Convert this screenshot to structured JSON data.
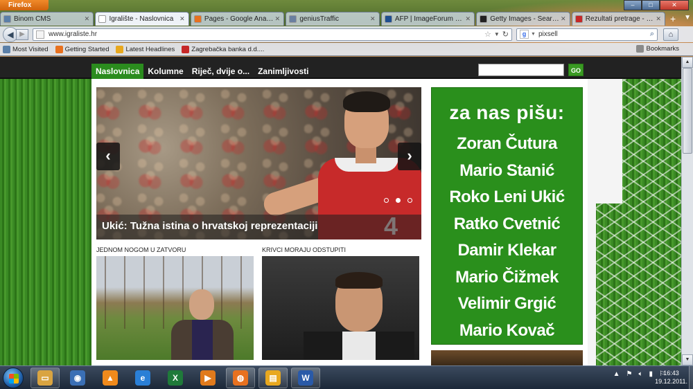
{
  "browser": {
    "app_button": "Firefox",
    "tabs": [
      {
        "label": "Binom CMS",
        "active": false,
        "favicon_color": "#5b7fa8"
      },
      {
        "label": "Igralište - Naslovnica",
        "active": true,
        "favicon_color": "#ffffff"
      },
      {
        "label": "Pages - Google Analytics",
        "active": false,
        "favicon_color": "#e8711f"
      },
      {
        "label": "geniusTraffic",
        "active": false,
        "favicon_color": "#6a7fa0"
      },
      {
        "label": "AFP | ImageForum Down...",
        "active": false,
        "favicon_color": "#1f4f8f"
      },
      {
        "label": "Getty Images - Search: cr...",
        "active": false,
        "favicon_color": "#222222"
      },
      {
        "label": "Rezultati pretrage - Pixsel...",
        "active": false,
        "favicon_color": "#c62828"
      }
    ],
    "url": "www.igraliste.hr",
    "search_value": "pixsell",
    "bookmarks": [
      {
        "label": "Most Visited",
        "icon": "bookmark-icon",
        "color": "#5b7fa8"
      },
      {
        "label": "Getting Started",
        "icon": "firefox-icon",
        "color": "#e8711f"
      },
      {
        "label": "Latest Headlines",
        "icon": "rss-icon",
        "color": "#e8a81f"
      },
      {
        "label": "Zagrebačka banka d.d....",
        "icon": "bank-icon",
        "color": "#c62828"
      }
    ],
    "bookmarks_menu": "Bookmarks"
  },
  "site": {
    "menu": [
      "Naslovnica",
      "Kolumne",
      "Riječ, dvije o...",
      "Zanimljivosti"
    ],
    "active_menu": "Naslovnica",
    "search_go": "GO",
    "slider": {
      "caption": "Ukić: Tužna istina o hrvatskoj reprezentaciji",
      "jersey_number": "4",
      "dots": 3,
      "active_dot": 1
    },
    "teasers": [
      {
        "title": "JEDNOM NOGOM U ZATVORU"
      },
      {
        "title": "KRIVCI MORAJU ODSTUPITI"
      }
    ],
    "side_box": {
      "title": "za nas pišu:",
      "authors": [
        "Zoran Čutura",
        "Mario Stanić",
        "Roko Leni Ukić",
        "Ratko Cvetnić",
        "Damir Klekar",
        "Mario Čižmek",
        "Velimir Grgić",
        "Mario Kovač"
      ]
    }
  },
  "taskbar": {
    "apps": [
      {
        "name": "explorer-icon",
        "glyph": "▭",
        "color": "#d9a441",
        "open": true
      },
      {
        "name": "user-icon",
        "glyph": "◉",
        "color": "#3a6fb5",
        "open": false
      },
      {
        "name": "vlc-icon",
        "glyph": "▲",
        "color": "#f08a1c",
        "open": false
      },
      {
        "name": "internet-explorer-icon",
        "glyph": "e",
        "color": "#2a7fd6",
        "open": false
      },
      {
        "name": "excel-icon",
        "glyph": "X",
        "color": "#1f7a3a",
        "open": false
      },
      {
        "name": "media-player-icon",
        "glyph": "▶",
        "color": "#e07a1c",
        "open": false
      },
      {
        "name": "firefox-icon",
        "glyph": "◍",
        "color": "#e8711f",
        "open": true
      },
      {
        "name": "pictures-icon",
        "glyph": "▤",
        "color": "#e8a81f",
        "open": true
      },
      {
        "name": "word-icon",
        "glyph": "W",
        "color": "#2a5aa8",
        "open": true
      }
    ],
    "time": "16:43",
    "date": "19.12.2011."
  }
}
